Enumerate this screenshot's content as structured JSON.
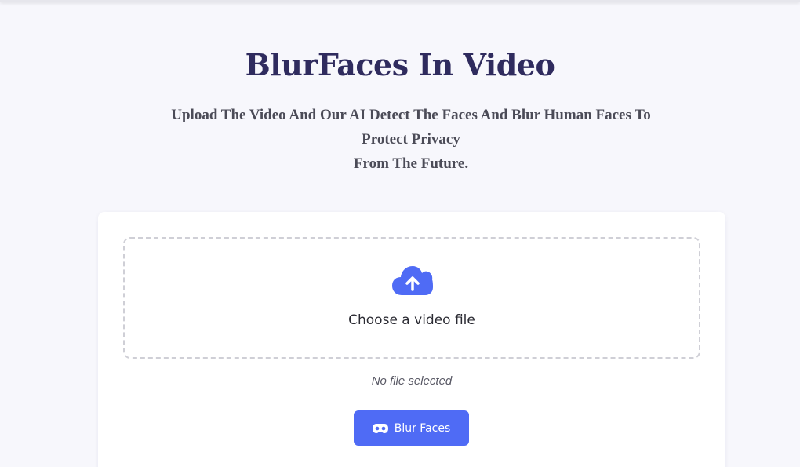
{
  "header": {
    "title": "BlurFaces In Video",
    "subtitle_lines": [
      "Upload The Video And Our AI Detect The Faces And Blur Human Faces To",
      "Protect Privacy",
      "From The Future."
    ]
  },
  "upload": {
    "icon": "cloud-upload-icon",
    "label": "Choose a video file",
    "status": "No file selected"
  },
  "action": {
    "icon": "mask-icon",
    "label": "Blur Faces"
  },
  "colors": {
    "accent": "#4f6bf5",
    "title": "#2f2b5e",
    "background": "#f7f7fc"
  }
}
